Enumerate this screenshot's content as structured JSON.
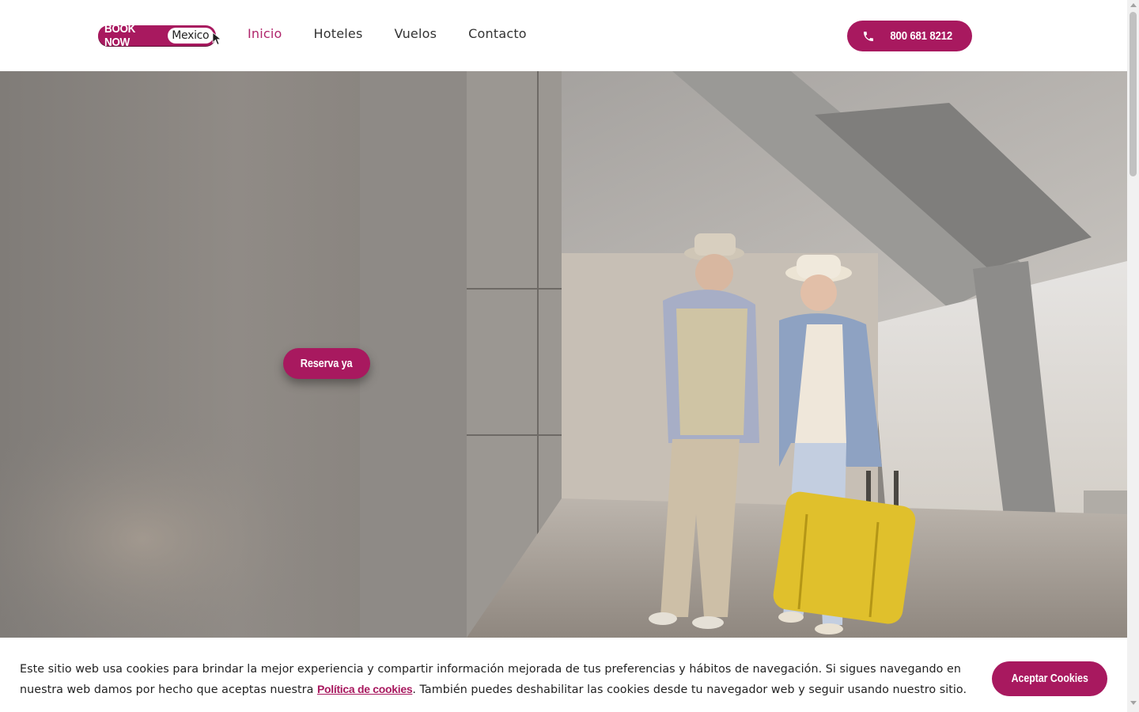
{
  "header": {
    "logo": {
      "part1": "BOOK NOW",
      "part2": "Mexico"
    },
    "nav": [
      {
        "label": "Inicio",
        "active": true
      },
      {
        "label": "Hoteles",
        "active": false
      },
      {
        "label": "Vuelos",
        "active": false
      },
      {
        "label": "Contacto",
        "active": false
      }
    ],
    "phone": {
      "label": "800 681 8212",
      "icon": "phone-icon"
    }
  },
  "hero": {
    "cta_label": "Reserva ya",
    "image": "senior couple walking in airport terminal with yellow suitcase"
  },
  "cookie_banner": {
    "text_before": "Este sitio web usa cookies para brindar la mejor experiencia y compartir información mejorada de tus preferencias y hábitos de navegación. Si sigues navegando en nuestra web damos por hecho que aceptas nuestra ",
    "link_label": "Política de cookies",
    "text_after": ". También puedes deshabilitar las cookies desde tu navegador web y seguir usando nuestro sitio.",
    "accept_label": "Aceptar Cookies"
  },
  "colors": {
    "brand": "#a8195f",
    "nav_active": "#b0256b",
    "text": "#333333"
  }
}
